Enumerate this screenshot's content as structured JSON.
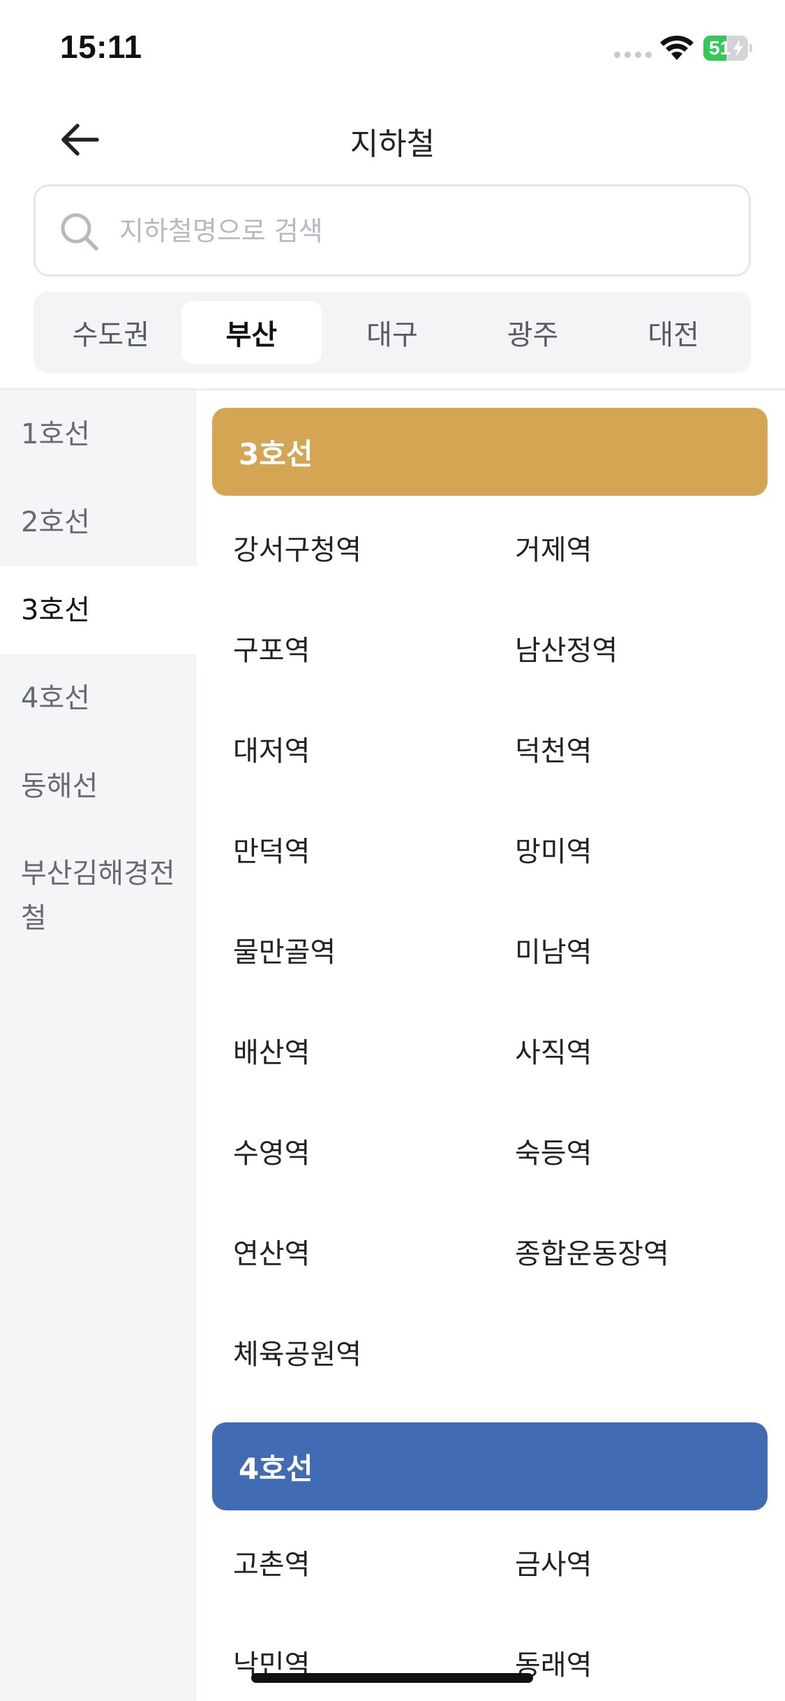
{
  "status_bar": {
    "time": "15:11",
    "battery_level": "51",
    "battery_fraction": 0.51
  },
  "header": {
    "title": "지하철",
    "back_icon": "arrow-left-icon"
  },
  "search": {
    "placeholder": "지하철명으로 검색",
    "value": "",
    "icon": "search-icon"
  },
  "region_tabs": [
    {
      "label": "수도권",
      "active": false
    },
    {
      "label": "부산",
      "active": true
    },
    {
      "label": "대구",
      "active": false
    },
    {
      "label": "광주",
      "active": false
    },
    {
      "label": "대전",
      "active": false
    }
  ],
  "lines": [
    {
      "label": "1호선",
      "active": false
    },
    {
      "label": "2호선",
      "active": false
    },
    {
      "label": "3호선",
      "active": true
    },
    {
      "label": "4호선",
      "active": false
    },
    {
      "label": "동해선",
      "active": false
    },
    {
      "label": "부산김해경전철",
      "active": false
    }
  ],
  "sections": [
    {
      "title": "3호선",
      "color": "#D4A553",
      "stations": [
        "강서구청역",
        "거제역",
        "구포역",
        "남산정역",
        "대저역",
        "덕천역",
        "만덕역",
        "망미역",
        "물만골역",
        "미남역",
        "배산역",
        "사직역",
        "수영역",
        "숙등역",
        "연산역",
        "종합운동장역",
        "체육공원역"
      ]
    },
    {
      "title": "4호선",
      "color": "#416CB4",
      "stations": [
        "고촌역",
        "금사역",
        "낙민역",
        "동래역"
      ]
    }
  ],
  "colors": {
    "sidebar_bg": "#F4F5F7",
    "tab_bar_bg": "#F3F4F6",
    "battery_green": "#34C759"
  }
}
